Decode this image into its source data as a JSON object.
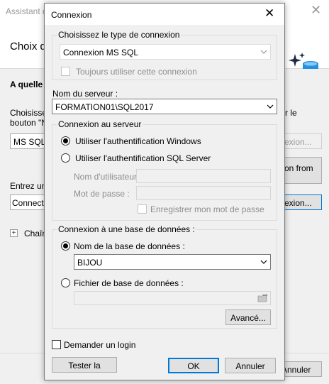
{
  "wizard": {
    "title": "Assistant d",
    "heading": "Choix d",
    "question": "A quelle",
    "choose_text_line1": "Choisissez",
    "choose_text_line2": "bouton \"N",
    "right_text_line1": "r le",
    "ms_sql_value": "MS SQL:",
    "connexion_btn_disabled": "exion...",
    "from_btn_line1": "on from",
    "enter_text": "Entrez un",
    "connection_field": "Connectio",
    "connexion_btn": "exion...",
    "expand_symbol": "+",
    "chain_text": "Chaîne",
    "cancel_btn": "Annuler"
  },
  "dialog": {
    "title": "Connexion",
    "connection_type_group": "Choisissez le type de connexion",
    "connection_type_value": "Connexion MS SQL",
    "always_use_label": "Toujours utiliser cette connexion",
    "server_name_label": "Nom du serveur :",
    "server_name_value": "FORMATION01\\SQL2017",
    "server_connection_group": "Connexion au serveur",
    "auth_windows_label": "Utiliser l'authentification Windows",
    "auth_sql_label": "Utiliser l'authentification SQL Server",
    "username_label": "Nom d'utilisateur",
    "password_label": "Mot de passe :",
    "save_password_label": "Enregistrer mon mot de passe",
    "database_group": "Connexion à une base de données :",
    "db_name_label": "Nom de la base de données :",
    "db_name_value": "BIJOU",
    "db_file_label": "Fichier de base de données :",
    "advanced_button": "Avancé...",
    "ask_login_label": "Demander un login",
    "test_button": "Tester la",
    "ok_button": "OK",
    "cancel_button": "Annuler"
  },
  "colors": {
    "accent": "#0078d7",
    "dialog_bg": "#f0f0f0"
  }
}
